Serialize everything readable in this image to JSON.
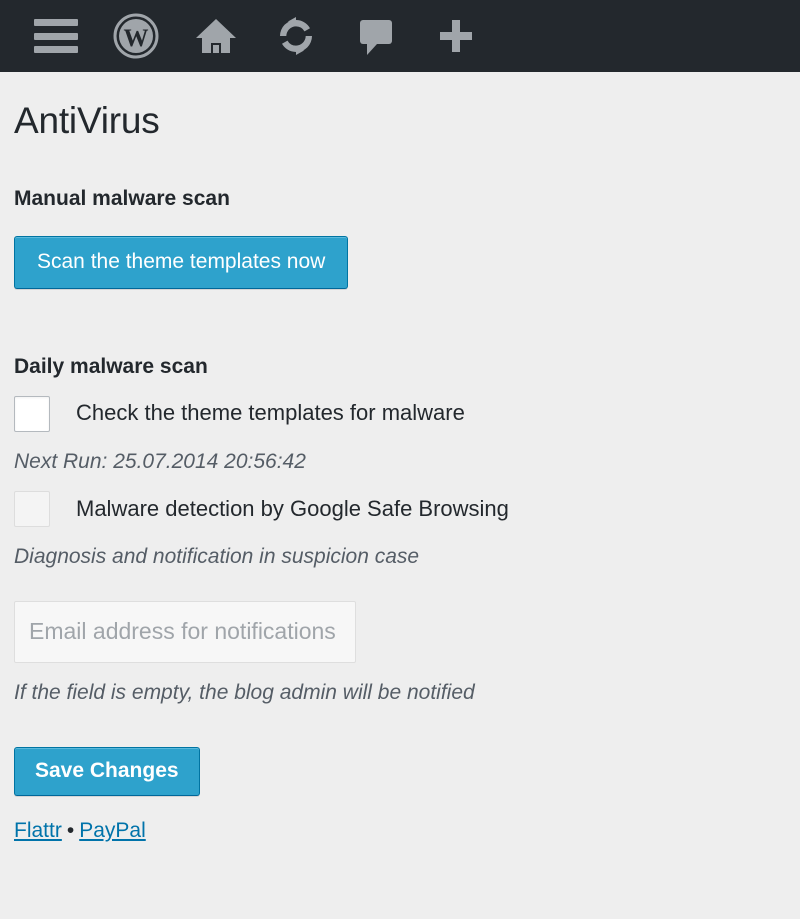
{
  "adminbar": {
    "items": [
      {
        "name": "menu-toggle",
        "icon": "hamburger-menu-icon",
        "label": "Menu"
      },
      {
        "name": "wordpress-logo",
        "icon": "wordpress-logo-icon",
        "label": "About WordPress"
      },
      {
        "name": "site-home",
        "icon": "home-icon",
        "label": "Visit Site"
      },
      {
        "name": "updates",
        "icon": "refresh-icon",
        "label": "Updates"
      },
      {
        "name": "comments",
        "icon": "comment-bubble-icon",
        "label": "Comments"
      },
      {
        "name": "new-content",
        "icon": "plus-icon",
        "label": "New"
      }
    ]
  },
  "page": {
    "title": "AntiVirus"
  },
  "manual_scan": {
    "heading": "Manual malware scan",
    "button_label": "Scan the theme templates now"
  },
  "daily_scan": {
    "heading": "Daily malware scan",
    "theme_check": {
      "label": "Check the theme templates for malware",
      "checked": false,
      "hint": "Next Run: 25.07.2014 20:56:42"
    },
    "safe_browsing": {
      "label": "Malware detection by Google Safe Browsing",
      "checked": false,
      "hint": "Diagnosis and notification in suspicion case"
    },
    "email": {
      "value": "",
      "placeholder": "Email address for notifications",
      "hint": "If the field is empty, the blog admin will be notified"
    }
  },
  "form": {
    "save_label": "Save Changes"
  },
  "footer": {
    "links": [
      {
        "label": "Flattr"
      },
      {
        "label": "PayPal"
      }
    ],
    "separator": "•"
  },
  "colors": {
    "adminbar_bg": "#23282d",
    "page_bg": "#eeeeee",
    "button_primary": "#2ea2cc",
    "button_primary_border": "#0074a2",
    "link": "#0073aa",
    "icon": "#a0a5aa",
    "hint_text": "#555d66"
  }
}
